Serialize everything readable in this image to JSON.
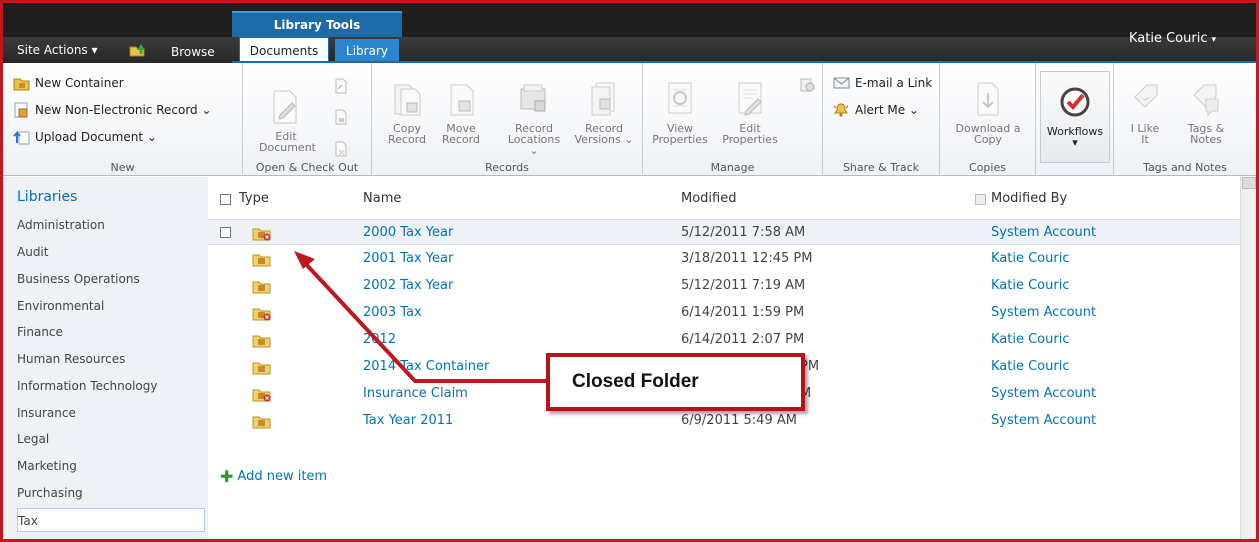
{
  "topbar": {
    "site_actions": "Site Actions ▾",
    "browse": "Browse",
    "library_tools": "Library Tools",
    "tabs": [
      "Documents",
      "Library"
    ],
    "user": "Katie Couric"
  },
  "ribbon": {
    "new": {
      "label": "New",
      "items": [
        "New Container",
        "New Non-Electronic Record ⌄",
        "Upload Document ⌄"
      ]
    },
    "open": {
      "label": "Open & Check Out",
      "edit_line1": "Edit",
      "edit_line2": "Document"
    },
    "records": {
      "label": "Records",
      "buttons": [
        {
          "l1": "Copy",
          "l2": "Record"
        },
        {
          "l1": "Move",
          "l2": "Record"
        },
        {
          "l1": "Record",
          "l2": "Locations ⌄"
        },
        {
          "l1": "Record",
          "l2": "Versions ⌄"
        }
      ]
    },
    "manage": {
      "label": "Manage",
      "buttons": [
        {
          "l1": "View",
          "l2": "Properties"
        },
        {
          "l1": "Edit",
          "l2": "Properties"
        }
      ]
    },
    "share": {
      "label": "Share & Track",
      "email": "E-mail a Link",
      "alert": "Alert Me ⌄"
    },
    "copies": {
      "label": "Copies",
      "l1": "Download a",
      "l2": "Copy"
    },
    "workflows": {
      "label": "Workflows",
      "caret": "▾"
    },
    "tags": {
      "label": "Tags and Notes",
      "like_l1": "I Like",
      "like_l2": "It",
      "tags_l1": "Tags &",
      "tags_l2": "Notes"
    }
  },
  "sidebar": {
    "title": "Libraries",
    "items": [
      "Administration",
      "Audit",
      "Business Operations",
      "Environmental",
      "Finance",
      "Human Resources",
      "Information Technology",
      "Insurance",
      "Legal",
      "Marketing",
      "Purchasing",
      "Tax"
    ],
    "selected": "Tax"
  },
  "list": {
    "headers": {
      "type": "Type",
      "name": "Name",
      "modified": "Modified",
      "modified_by": "Modified By"
    },
    "rows": [
      {
        "name": "2000 Tax Year",
        "modified": "5/12/2011 7:58 AM",
        "by": "System Account",
        "closed": true
      },
      {
        "name": "2001 Tax Year",
        "modified": "3/18/2011 12:45 PM",
        "by": "Katie Couric",
        "closed": false
      },
      {
        "name": "2002 Tax Year",
        "modified": "5/12/2011 7:19 AM",
        "by": "Katie Couric",
        "closed": false
      },
      {
        "name": "2003 Tax",
        "modified": "6/14/2011 1:59 PM",
        "by": "System Account",
        "closed": true
      },
      {
        "name": "2012",
        "modified": "6/14/2011 2:07 PM",
        "by": "Katie Couric",
        "closed": false
      },
      {
        "name": "2014 Tax Container",
        "modified": "PM",
        "by": "Katie Couric",
        "closed": false
      },
      {
        "name": "Insurance Claim",
        "modified": "M",
        "by": "System Account",
        "closed": true
      },
      {
        "name": "Tax Year 2011",
        "modified": "6/9/2011 5:49 AM",
        "by": "System Account",
        "closed": false
      }
    ],
    "add_new": "Add new item"
  },
  "callout": {
    "text": "Closed Folder"
  },
  "colors": {
    "accent": "#0072bc",
    "callout_border": "#b5121b",
    "ribbon_tab": "#1c6aa6"
  }
}
